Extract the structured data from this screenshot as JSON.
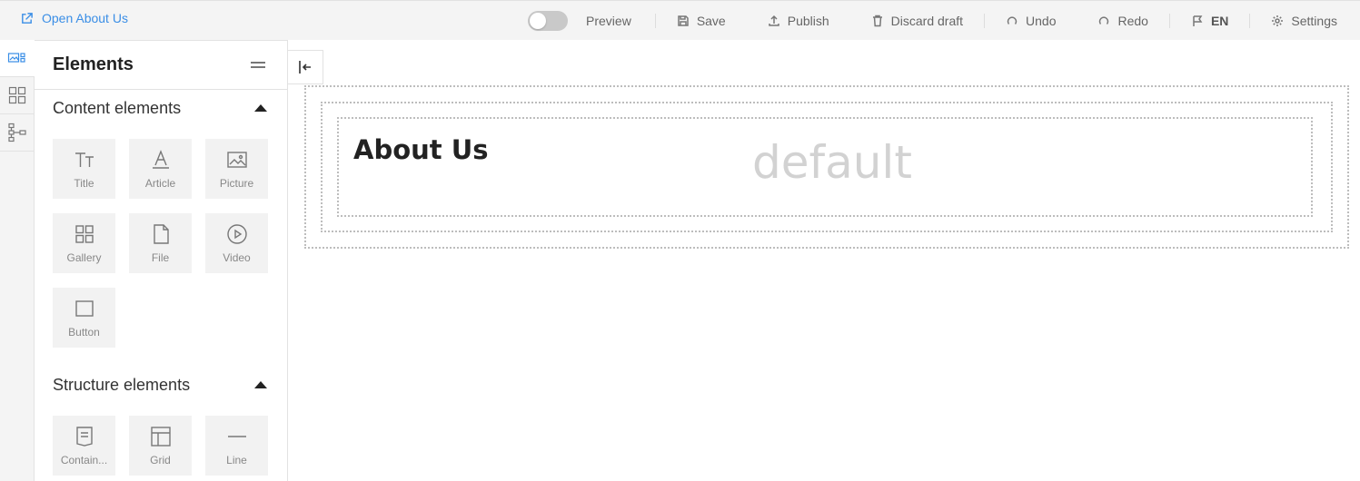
{
  "header": {
    "open_link": "Open About Us",
    "preview_label": "Preview",
    "save_label": "Save",
    "publish_label": "Publish",
    "discard_label": "Discard draft",
    "undo_label": "Undo",
    "redo_label": "Redo",
    "language": "EN",
    "settings_label": "Settings",
    "preview_enabled": false
  },
  "rail": {
    "items": [
      {
        "icon": "elements-icon",
        "active": true
      },
      {
        "icon": "layout-grid-icon",
        "active": false
      },
      {
        "icon": "tree-structure-icon",
        "active": false
      }
    ]
  },
  "panel": {
    "title": "Elements",
    "content_section": {
      "label": "Content elements",
      "items": [
        {
          "label": "Title",
          "icon": "title-icon"
        },
        {
          "label": "Article",
          "icon": "article-icon"
        },
        {
          "label": "Picture",
          "icon": "picture-icon"
        },
        {
          "label": "Gallery",
          "icon": "gallery-icon"
        },
        {
          "label": "File",
          "icon": "file-icon"
        },
        {
          "label": "Video",
          "icon": "video-icon"
        },
        {
          "label": "Button",
          "icon": "button-icon"
        }
      ]
    },
    "structure_section": {
      "label": "Structure elements",
      "items": [
        {
          "label": "Contain...",
          "icon": "container-icon"
        },
        {
          "label": "Grid",
          "icon": "grid-icon"
        },
        {
          "label": "Line",
          "icon": "line-icon"
        }
      ]
    }
  },
  "canvas": {
    "heading": "About Us",
    "placeholder": "default"
  },
  "colors": {
    "accent": "#3a8ee6",
    "topbar_bg": "#f4f4f4",
    "tile_bg": "#f2f2f2"
  }
}
